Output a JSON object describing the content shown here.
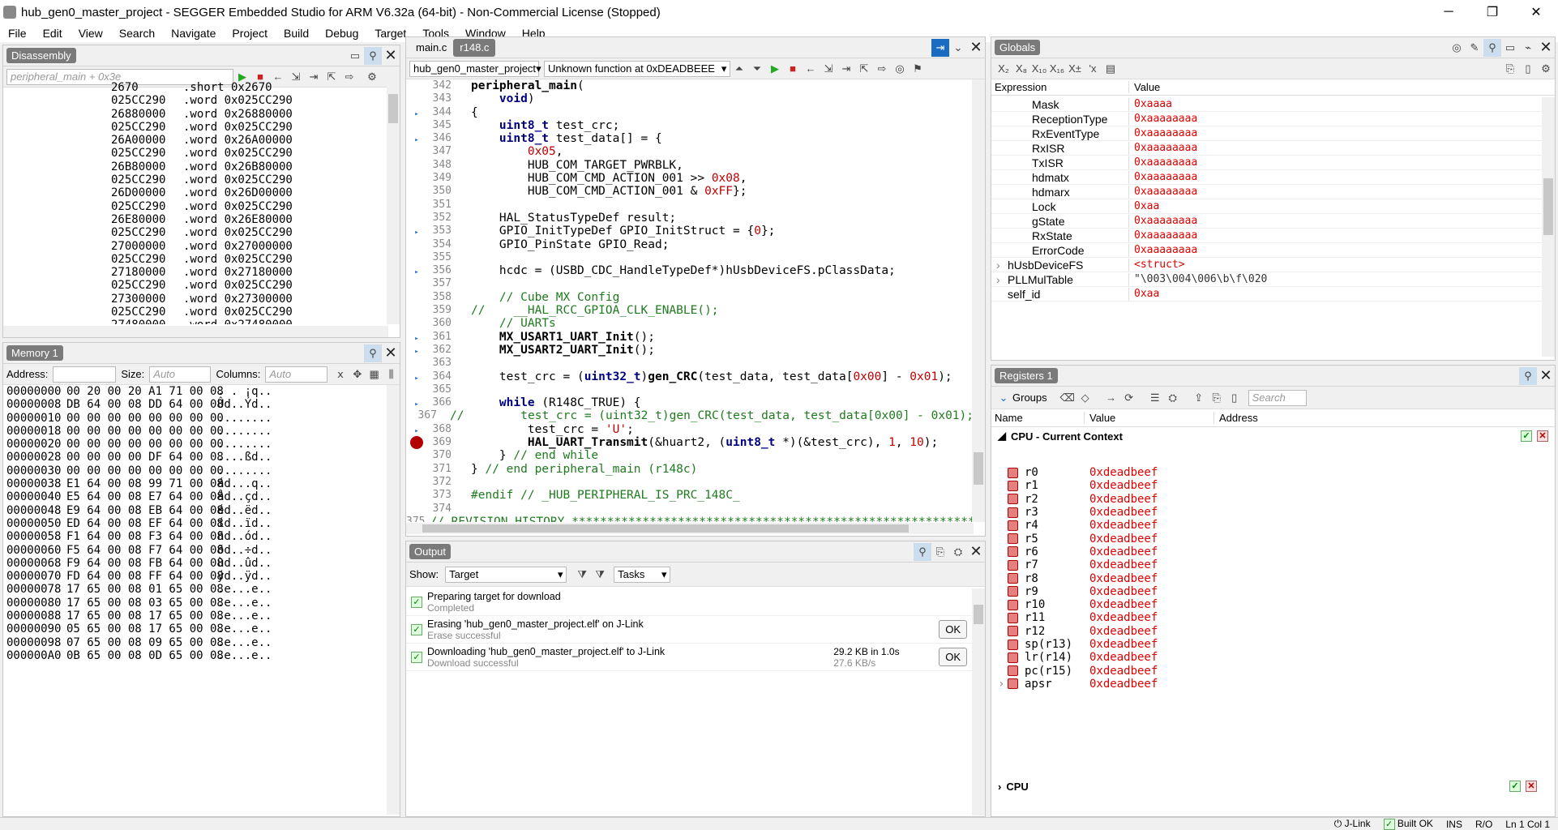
{
  "title": "hub_gen0_master_project - SEGGER Embedded Studio for ARM V6.32a (64-bit) - Non-Commercial License (Stopped)",
  "window": {
    "minimize": "─",
    "restore": "❐",
    "close": "✕"
  },
  "menu": [
    "File",
    "Edit",
    "View",
    "Search",
    "Navigate",
    "Project",
    "Build",
    "Debug",
    "Target",
    "Tools",
    "Window",
    "Help"
  ],
  "disassembly": {
    "title": "Disassembly",
    "placeholder": "peripheral_main + 0x3e",
    "rows": [
      [
        "2670",
        ".short 0x2670"
      ],
      [
        "025CC290",
        ".word 0x025CC290"
      ],
      [
        "26880000",
        ".word 0x26880000"
      ],
      [
        "025CC290",
        ".word 0x025CC290"
      ],
      [
        "26A00000",
        ".word 0x26A00000"
      ],
      [
        "025CC290",
        ".word 0x025CC290"
      ],
      [
        "26B80000",
        ".word 0x26B80000"
      ],
      [
        "025CC290",
        ".word 0x025CC290"
      ],
      [
        "26D00000",
        ".word 0x26D00000"
      ],
      [
        "025CC290",
        ".word 0x025CC290"
      ],
      [
        "26E80000",
        ".word 0x26E80000"
      ],
      [
        "025CC290",
        ".word 0x025CC290"
      ],
      [
        "27000000",
        ".word 0x27000000"
      ],
      [
        "025CC290",
        ".word 0x025CC290"
      ],
      [
        "27180000",
        ".word 0x27180000"
      ],
      [
        "025CC290",
        ".word 0x025CC290"
      ],
      [
        "27300000",
        ".word 0x27300000"
      ],
      [
        "025CC290",
        ".word 0x025CC290"
      ],
      [
        "27480000",
        ".word 0x27480000"
      ]
    ]
  },
  "memory": {
    "title": "Memory 1",
    "address_label": "Address:",
    "size_label": "Size:",
    "size_placeholder": "Auto",
    "columns_label": "Columns:",
    "columns_placeholder": "Auto",
    "rows": [
      [
        "00000000",
        "00 20 00 20 A1 71 00 08",
        ". . ¡q.."
      ],
      [
        "00000008",
        "DB 64 00 08 DD 64 00 08",
        "Ûd..Ýd.."
      ],
      [
        "00000010",
        "00 00 00 00 00 00 00 00",
        "........"
      ],
      [
        "00000018",
        "00 00 00 00 00 00 00 00",
        "........"
      ],
      [
        "00000020",
        "00 00 00 00 00 00 00 00",
        "........"
      ],
      [
        "00000028",
        "00 00 00 00 DF 64 00 08",
        "....ßd.."
      ],
      [
        "00000030",
        "00 00 00 00 00 00 00 00",
        "........"
      ],
      [
        "00000038",
        "E1 64 00 08 99 71 00 08",
        "ád...q.."
      ],
      [
        "00000040",
        "E5 64 00 08 E7 64 00 08",
        "åd..çd.."
      ],
      [
        "00000048",
        "E9 64 00 08 EB 64 00 08",
        "éd..ëd.."
      ],
      [
        "00000050",
        "ED 64 00 08 EF 64 00 08",
        "íd..ïd.."
      ],
      [
        "00000058",
        "F1 64 00 08 F3 64 00 08",
        "ñd..ód.."
      ],
      [
        "00000060",
        "F5 64 00 08 F7 64 00 08",
        "õd..÷d.."
      ],
      [
        "00000068",
        "F9 64 00 08 FB 64 00 08",
        "ùd..ûd.."
      ],
      [
        "00000070",
        "FD 64 00 08 FF 64 00 08",
        "ýd..ÿd.."
      ],
      [
        "00000078",
        "17 65 00 08 01 65 00 08",
        ".e...e.."
      ],
      [
        "00000080",
        "17 65 00 08 03 65 00 08",
        ".e...e.."
      ],
      [
        "00000088",
        "17 65 00 08 17 65 00 08",
        ".e...e.."
      ],
      [
        "00000090",
        "05 65 00 08 17 65 00 08",
        ".e...e.."
      ],
      [
        "00000098",
        "07 65 00 08 09 65 00 08",
        ".e...e.."
      ],
      [
        "000000A0",
        "0B 65 00 08 0D 65 00 08",
        ".e...e.."
      ]
    ]
  },
  "editor": {
    "tabs": [
      "main.c",
      "r148.c"
    ],
    "project": "hub_gen0_master_project",
    "function": "Unknown function at 0xDEADBEEE",
    "lines": [
      {
        "n": "342",
        "bp": "",
        "html": "<span class=\"bold\">peripheral_main</span>("
      },
      {
        "n": "343",
        "bp": "",
        "html": "    <span class=\"kw\">void</span>)"
      },
      {
        "n": "344",
        "bp": "arrow",
        "html": "{"
      },
      {
        "n": "345",
        "bp": "",
        "html": "    <span class=\"kw\">uint8_t</span> test_crc;"
      },
      {
        "n": "346",
        "bp": "arrow",
        "html": "    <span class=\"kw\">uint8_t</span> test_data[] = {"
      },
      {
        "n": "347",
        "bp": "",
        "html": "        <span class=\"num\">0x05</span>,"
      },
      {
        "n": "348",
        "bp": "",
        "html": "        HUB_COM_TARGET_PWRBLK,"
      },
      {
        "n": "349",
        "bp": "",
        "html": "        HUB_COM_CMD_ACTION_001 &gt;&gt; <span class=\"num\">0x08</span>,"
      },
      {
        "n": "350",
        "bp": "",
        "html": "        HUB_COM_CMD_ACTION_001 &amp; <span class=\"num\">0xFF</span>};"
      },
      {
        "n": "351",
        "bp": "",
        "html": ""
      },
      {
        "n": "352",
        "bp": "",
        "html": "    HAL_StatusTypeDef result;"
      },
      {
        "n": "353",
        "bp": "arrow",
        "html": "    GPIO_InitTypeDef GPIO_InitStruct = {<span class=\"num\">0</span>};"
      },
      {
        "n": "354",
        "bp": "",
        "html": "    GPIO_PinState GPIO_Read;"
      },
      {
        "n": "355",
        "bp": "",
        "html": ""
      },
      {
        "n": "356",
        "bp": "arrow",
        "html": "    hcdc = (USBD_CDC_HandleTypeDef*)hUsbDeviceFS.pClassData;"
      },
      {
        "n": "357",
        "bp": "",
        "html": ""
      },
      {
        "n": "358",
        "bp": "",
        "html": "    <span class=\"cm\">// Cube MX Config</span>"
      },
      {
        "n": "359",
        "bp": "",
        "html": "<span class=\"cm\">//    __HAL_RCC_GPIOA_CLK_ENABLE();</span>"
      },
      {
        "n": "360",
        "bp": "",
        "html": "    <span class=\"cm\">// UARTs</span>"
      },
      {
        "n": "361",
        "bp": "arrow",
        "html": "    <span class=\"bold\">MX_USART1_UART_Init</span>();"
      },
      {
        "n": "362",
        "bp": "arrow",
        "html": "    <span class=\"bold\">MX_USART2_UART_Init</span>();"
      },
      {
        "n": "363",
        "bp": "",
        "html": ""
      },
      {
        "n": "364",
        "bp": "arrow",
        "html": "    test_crc = (<span class=\"kw\">uint32_t</span>)<span class=\"bold\">gen_CRC</span>(test_data, test_data[<span class=\"num\">0x00</span>] - <span class=\"num\">0x01</span>);"
      },
      {
        "n": "365",
        "bp": "",
        "html": ""
      },
      {
        "n": "366",
        "bp": "arrow",
        "html": "    <span class=\"kw\">while</span> (R148C_TRUE) {"
      },
      {
        "n": "367",
        "bp": "",
        "html": "<span class=\"cm\">//        test_crc = (uint32_t)gen_CRC(test_data, test_data[0x00] - 0x01);</span>"
      },
      {
        "n": "368",
        "bp": "arrow",
        "html": "        test_crc = <span class=\"num\">'U'</span>;"
      },
      {
        "n": "369",
        "bp": "break",
        "html": "        <span class=\"bold\">HAL_UART_Transmit</span>(&amp;huart2, (<span class=\"kw\">uint8_t</span> *)(&amp;test_crc), <span class=\"num\">1</span>, <span class=\"num\">10</span>);"
      },
      {
        "n": "370",
        "bp": "",
        "html": "    } <span class=\"cm\">// end while</span>"
      },
      {
        "n": "371",
        "bp": "",
        "html": "} <span class=\"cm\">// end peripheral_main (r148c)</span>"
      },
      {
        "n": "372",
        "bp": "",
        "html": ""
      },
      {
        "n": "373",
        "bp": "",
        "html": "<span class=\"cm\">#endif // _HUB_PERIPHERAL_IS_PRC_148C_</span>"
      },
      {
        "n": "374",
        "bp": "",
        "html": ""
      },
      {
        "n": "375",
        "bp": "",
        "html": "<span class=\"cm\">// REVISION HISTORY ***********************************************************</span>"
      }
    ]
  },
  "output": {
    "title": "Output",
    "show_label": "Show:",
    "show_value": "Target",
    "tasks_value": "Tasks",
    "items": [
      {
        "title": "Preparing target for download",
        "sub": "Completed",
        "size": "",
        "rate": "",
        "ok": false
      },
      {
        "title": "Erasing 'hub_gen0_master_project.elf' on J-Link",
        "sub": "Erase successful",
        "size": "",
        "rate": "",
        "ok": true
      },
      {
        "title": "Downloading 'hub_gen0_master_project.elf' to J-Link",
        "sub": "Download successful",
        "size": "29.2 KB in 1.0s",
        "rate": "27.6 KB/s",
        "ok": true
      }
    ],
    "ok_label": "OK"
  },
  "globals": {
    "title": "Globals",
    "col_expr": "Expression",
    "col_value": "Value",
    "rows": [
      {
        "name": "Mask",
        "value": "0xaaaa",
        "indent": 2,
        "exp": "",
        "red": true
      },
      {
        "name": "ReceptionType",
        "value": "0xaaaaaaaa",
        "indent": 2,
        "exp": "",
        "red": true
      },
      {
        "name": "RxEventType",
        "value": "0xaaaaaaaa",
        "indent": 2,
        "exp": "",
        "red": true
      },
      {
        "name": "RxISR",
        "value": "0xaaaaaaaa",
        "indent": 2,
        "exp": "",
        "red": true
      },
      {
        "name": "TxISR",
        "value": "0xaaaaaaaa",
        "indent": 2,
        "exp": "",
        "red": true
      },
      {
        "name": "hdmatx",
        "value": "0xaaaaaaaa",
        "indent": 2,
        "exp": "",
        "red": true
      },
      {
        "name": "hdmarx",
        "value": "0xaaaaaaaa",
        "indent": 2,
        "exp": "",
        "red": true
      },
      {
        "name": "Lock",
        "value": "0xaa",
        "indent": 2,
        "exp": "",
        "red": true
      },
      {
        "name": "gState",
        "value": "0xaaaaaaaa",
        "indent": 2,
        "exp": "",
        "red": true
      },
      {
        "name": "RxState",
        "value": "0xaaaaaaaa",
        "indent": 2,
        "exp": "",
        "red": true
      },
      {
        "name": "ErrorCode",
        "value": "0xaaaaaaaa",
        "indent": 2,
        "exp": "",
        "red": true
      },
      {
        "name": "hUsbDeviceFS",
        "value": "<struct>",
        "indent": 1,
        "exp": "›",
        "red": true
      },
      {
        "name": "PLLMulTable",
        "value": "\"\\003\\004\\006\\b\\f\\020",
        "indent": 1,
        "exp": "›",
        "red": false
      },
      {
        "name": "self_id",
        "value": "0xaa",
        "indent": 1,
        "exp": "",
        "red": true
      }
    ]
  },
  "registers": {
    "title": "Registers 1",
    "groups_label": "Groups",
    "search_placeholder": "Search",
    "col_name": "Name",
    "col_value": "Value",
    "col_address": "Address",
    "group": "CPU - Current Context",
    "rows": [
      [
        "r0",
        "0xdeadbeef"
      ],
      [
        "r1",
        "0xdeadbeef"
      ],
      [
        "r2",
        "0xdeadbeef"
      ],
      [
        "r3",
        "0xdeadbeef"
      ],
      [
        "r4",
        "0xdeadbeef"
      ],
      [
        "r5",
        "0xdeadbeef"
      ],
      [
        "r6",
        "0xdeadbeef"
      ],
      [
        "r7",
        "0xdeadbeef"
      ],
      [
        "r8",
        "0xdeadbeef"
      ],
      [
        "r9",
        "0xdeadbeef"
      ],
      [
        "r10",
        "0xdeadbeef"
      ],
      [
        "r11",
        "0xdeadbeef"
      ],
      [
        "r12",
        "0xdeadbeef"
      ],
      [
        "sp(r13)",
        "0xdeadbeef"
      ],
      [
        "lr(r14)",
        "0xdeadbeef"
      ],
      [
        "pc(r15)",
        "0xdeadbeef"
      ],
      [
        "apsr",
        "0xdeadbeef"
      ]
    ],
    "group2": "CPU"
  },
  "statusbar": {
    "jlink": "J-Link",
    "built": "Built OK",
    "ins": "INS",
    "ro": "R/O",
    "pos": "Ln 1 Col 1"
  },
  "colors": {
    "error_red": "#e00000",
    "keyword": "#000080",
    "comment": "#1e7b1e",
    "breakpoint": "#b00000"
  }
}
